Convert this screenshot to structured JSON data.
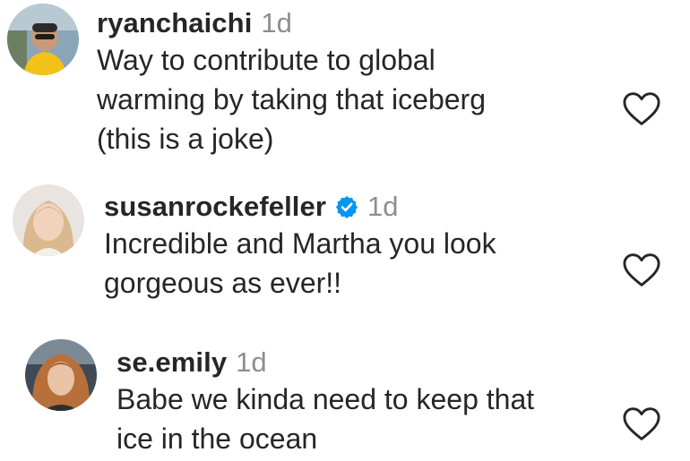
{
  "comments": [
    {
      "username": "ryanchaichi",
      "verified": false,
      "time": "1d",
      "text_lines": [
        "Way to contribute to global",
        "warming by taking that iceberg",
        "(this is a joke)"
      ],
      "avatar_icon": "avatar-photo",
      "like_icon": "heart-outline-icon"
    },
    {
      "username": "susanrockefeller",
      "verified": true,
      "time": "1d",
      "text_lines": [
        "Incredible and Martha you look",
        "gorgeous as ever!!"
      ],
      "avatar_icon": "avatar-photo",
      "like_icon": "heart-outline-icon"
    },
    {
      "username": "se.emily",
      "verified": false,
      "time": "1d",
      "text_lines": [
        "Babe we kinda need to keep that",
        "ice in the ocean"
      ],
      "avatar_icon": "avatar-photo",
      "like_icon": "heart-outline-icon"
    }
  ],
  "colors": {
    "text": "#262626",
    "muted": "#8e8e8e",
    "verified_blue": "#0095f6",
    "background": "#ffffff"
  }
}
